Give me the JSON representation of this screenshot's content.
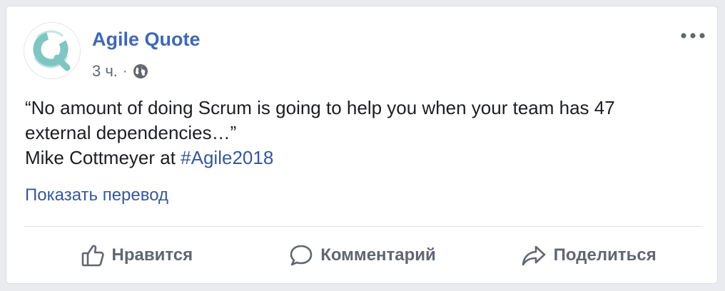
{
  "post": {
    "author": "Agile Quote",
    "time": "3 ч.",
    "separator": "·",
    "privacy_icon": "globe-icon",
    "more_icon": "more-horizontal-icon",
    "text_lines": {
      "line1": "“No amount of doing Scrum is going to help you when your team has 47",
      "line2": "external dependencies…”",
      "line3_prefix": "Mike Cottmeyer at ",
      "hashtag": "#Agile2018"
    },
    "translate_link": "Показать перевод"
  },
  "actions": {
    "like": "Нравится",
    "comment": "Комментарий",
    "share": "Поделиться"
  },
  "colors": {
    "brand_blue": "#4267b2",
    "link_blue": "#385898",
    "logo_teal": "#7fc5c1",
    "secondary_text": "#616770"
  }
}
